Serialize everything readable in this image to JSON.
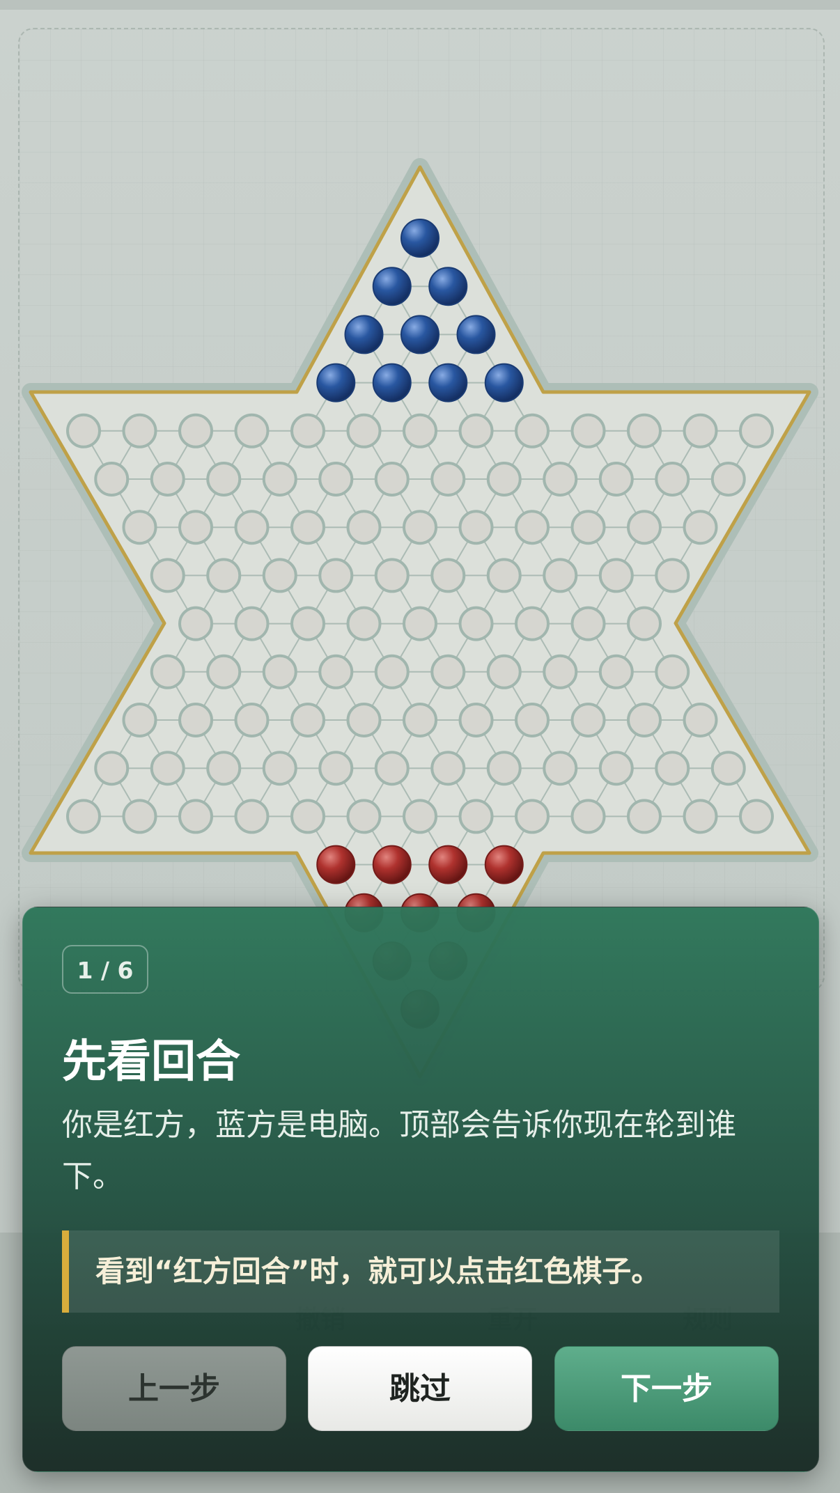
{
  "board": {
    "colors": {
      "star_fill": "#e8ebe5",
      "star_outline": "#c9a84a",
      "star_halo": "#b6c7c0",
      "empty_hole": "#e2e1da",
      "hole_ring": "#a9bfb6",
      "line": "#b4c4bd",
      "blue_piece": "#2a5aa8",
      "red_piece": "#b8322e"
    }
  },
  "under_controls": {
    "items": [
      "撤销",
      "重开",
      "规则",
      "新手"
    ]
  },
  "guide": {
    "step": "1 / 6",
    "title": "先看回合",
    "body": "你是红方，蓝方是电脑。顶部会告诉你现在轮到谁下。",
    "tip": "看到“红方回合”时，就可以点击红色棋子。",
    "buttons": {
      "prev": "上一步",
      "skip": "跳过",
      "next": "下一步"
    }
  }
}
